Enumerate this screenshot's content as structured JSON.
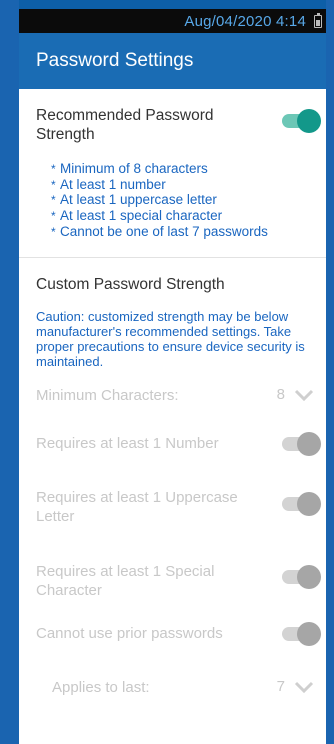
{
  "status_bar": {
    "time": "Aug/04/2020 4:14"
  },
  "header": {
    "title": "Password Settings"
  },
  "recommended": {
    "title": "Recommended Password Strength",
    "enabled": true,
    "rules": [
      "Minimum of 8 characters",
      "At least 1 number",
      "At least 1 uppercase letter",
      "At least 1 special character",
      "Cannot be one of last 7 passwords"
    ]
  },
  "custom": {
    "title": "Custom Password Strength",
    "caution": "Caution: customized strength may be below manufacturer's recommended settings. Take proper precautions to ensure device security is maintained.",
    "min_chars_label": "Minimum Characters:",
    "min_chars_value": "8",
    "number_label": "Requires at least 1 Number",
    "number_enabled": true,
    "uppercase_label": "Requires at least 1 Uppercase Letter",
    "uppercase_enabled": true,
    "special_label": "Requires at least 1 Special Character",
    "special_enabled": true,
    "prior_label": "Cannot use prior passwords",
    "prior_enabled": true,
    "applies_label": "Applies to last:",
    "applies_value": "7"
  },
  "colors": {
    "accent": "#1a6cb4",
    "toggle_on": "#13988a",
    "info_text": "#1a66c0"
  }
}
